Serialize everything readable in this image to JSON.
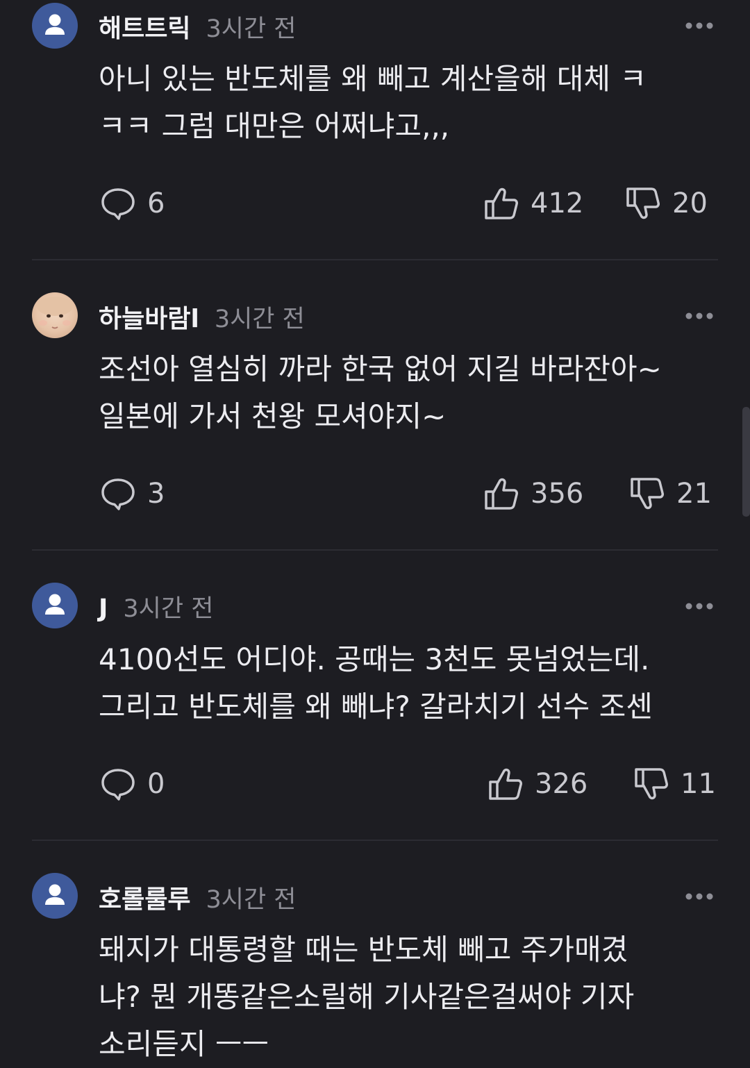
{
  "comments": [
    {
      "username": "해트트릭",
      "time": "3시간 전",
      "text_lines": [
        "아니 있는 반도체를 왜 빼고 계산을해 대체 ㅋ",
        "ㅋㅋ 그럼 대만은 어쩌냐고,,,"
      ],
      "replies": "6",
      "likes": "412",
      "dislikes": "20",
      "avatar": "default-user-icon"
    },
    {
      "username": "하늘바람l",
      "time": "3시간 전",
      "text_lines": [
        "조선아 열심히 까라 한국 없어 지길 바라잔아~",
        "일본에 가서 천왕 모셔야지~"
      ],
      "replies": "3",
      "likes": "356",
      "dislikes": "21",
      "avatar": "baby-photo"
    },
    {
      "username": "J",
      "time": "3시간 전",
      "text_lines": [
        "4100선도 어디야. 공때는 3천도 못넘었는데.",
        "그리고 반도체를 왜 빼냐? 갈라치기 선수 조센"
      ],
      "replies": "0",
      "likes": "326",
      "dislikes": "11",
      "avatar": "default-user-icon"
    },
    {
      "username": "호롤룰루",
      "time": "3시간 전",
      "text_lines": [
        "돼지가 대통령할 때는 반도체 빼고 주가매겼",
        "냐? 뭔 개똥같은소릴해 기사같은걸써야 기자",
        "소리듣지 ㅡㅡ"
      ],
      "avatar": "default-user-icon"
    }
  ],
  "colors": {
    "background": "#1d1d22",
    "avatar_default": "#3f5a9b",
    "divider": "#2c2c33"
  }
}
